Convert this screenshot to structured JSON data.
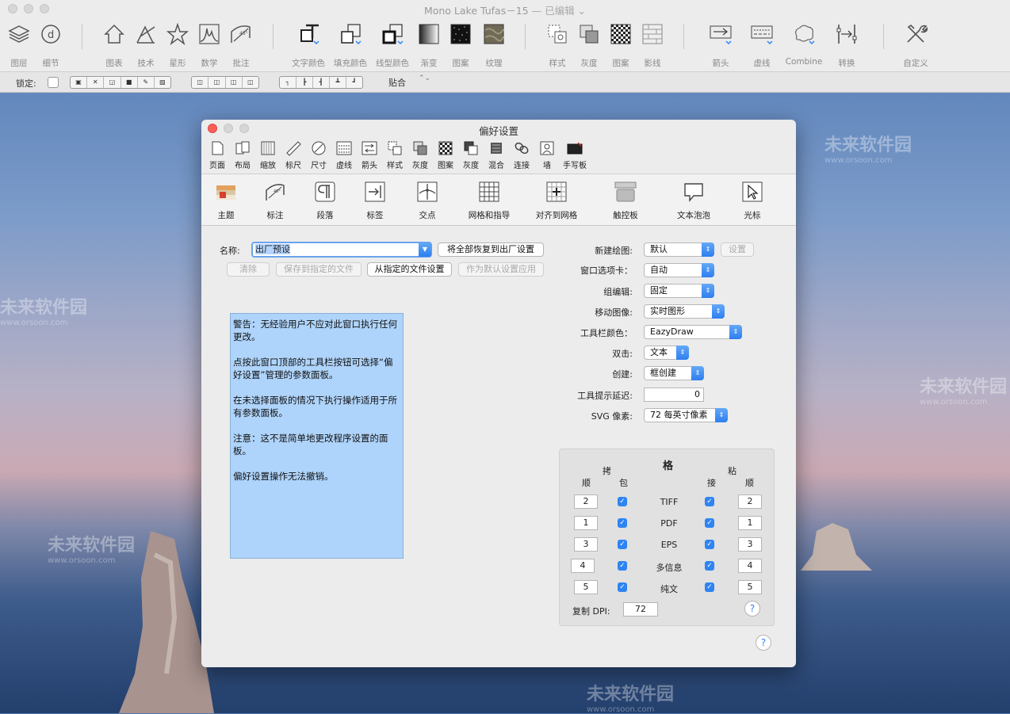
{
  "app": {
    "window_title": "Mono Lake Tufas－15",
    "window_status": " — 已编辑 ⌄"
  },
  "toolbar": {
    "items": [
      {
        "label": "图层",
        "icon": "layers-icon"
      },
      {
        "label": "细节",
        "icon": "detail-icon"
      },
      {
        "label": "图表",
        "icon": "house-shape-icon"
      },
      {
        "label": "技术",
        "icon": "technical-icon"
      },
      {
        "label": "星形",
        "icon": "star-icon"
      },
      {
        "label": "数学",
        "icon": "math-icon"
      },
      {
        "label": "批注",
        "icon": "annotation-icon"
      },
      {
        "label": "文字颜色",
        "icon": "text-color-icon"
      },
      {
        "label": "填充颜色",
        "icon": "fill-color-icon"
      },
      {
        "label": "线型颜色",
        "icon": "line-color-icon"
      },
      {
        "label": "渐变",
        "icon": "gradient-icon"
      },
      {
        "label": "图案",
        "icon": "pattern-icon"
      },
      {
        "label": "纹理",
        "icon": "texture-icon"
      },
      {
        "label": "样式",
        "icon": "style-icon"
      },
      {
        "label": "灰度",
        "icon": "gray-icon"
      },
      {
        "label": "图案",
        "icon": "checker-icon"
      },
      {
        "label": "影线",
        "icon": "hatch-icon"
      },
      {
        "label": "箭头",
        "icon": "arrow-icon"
      },
      {
        "label": "虚线",
        "icon": "dash-icon"
      },
      {
        "label": "Combine",
        "icon": "combine-icon"
      },
      {
        "label": "转换",
        "icon": "transform-icon"
      },
      {
        "label": "自定义",
        "icon": "customize-icon"
      }
    ]
  },
  "secondbar": {
    "lock_label": "锁定:",
    "snap_label": "贴合",
    "snap_arrows": "⌃⌄"
  },
  "prefs": {
    "title": "偏好设置",
    "icon_bar": [
      {
        "label": "页面",
        "icon": "page-icon"
      },
      {
        "label": "布局",
        "icon": "layout-icon"
      },
      {
        "label": "缩放",
        "icon": "zoom-icon"
      },
      {
        "label": "标尺",
        "icon": "ruler-icon"
      },
      {
        "label": "尺寸",
        "icon": "size-icon"
      },
      {
        "label": "虚线",
        "icon": "dash-line-icon"
      },
      {
        "label": "箭头",
        "icon": "arrowhead-icon"
      },
      {
        "label": "样式",
        "icon": "style-icon"
      },
      {
        "label": "灰度",
        "icon": "gray-icon"
      },
      {
        "label": "图案",
        "icon": "pattern-icon"
      },
      {
        "label": "灰度",
        "icon": "gray-scale-icon"
      },
      {
        "label": "混合",
        "icon": "blend-icon"
      },
      {
        "label": "连接",
        "icon": "link-icon"
      },
      {
        "label": "墙",
        "icon": "wall-icon"
      },
      {
        "label": "手写板",
        "icon": "tablet-icon"
      }
    ],
    "tabs": [
      {
        "label": "主题",
        "icon": "theme-icon"
      },
      {
        "label": "标注",
        "icon": "dimension-icon"
      },
      {
        "label": "段落",
        "icon": "paragraph-icon"
      },
      {
        "label": "标签",
        "icon": "tag-icon"
      },
      {
        "label": "交点",
        "icon": "intersection-icon"
      },
      {
        "label": "网格和指导",
        "icon": "grid-icon"
      },
      {
        "label": "对齐到网格",
        "icon": "snap-grid-icon"
      },
      {
        "label": "触控板",
        "icon": "trackpad-icon"
      },
      {
        "label": "文本泡泡",
        "icon": "speech-bubble-icon"
      },
      {
        "label": "光标",
        "icon": "cursor-icon"
      }
    ],
    "name_label": "名称:",
    "name_value": "出厂预设",
    "restore_button": "将全部恢复到出厂设置",
    "clear_button": "清除",
    "save_file_button": "保存到指定的文件",
    "from_file_button": "从指定的文件设置",
    "apply_default_button": "作为默认设置应用",
    "warning": {
      "p1": "警告：无经验用户不应对此窗口执行任何更改。",
      "p2": "点按此窗口顶部的工具栏按钮可选择“偏好设置”管理的参数面板。",
      "p3": "在未选择面板的情况下执行操作适用于所有参数面板。",
      "p4": " 注意：这不是简单地更改程序设置的面板。",
      "p5": "偏好设置操作无法撤销。"
    },
    "settings": {
      "new_drawing_label": "新建绘图:",
      "new_drawing_value": "默认",
      "setup_button": "设置",
      "window_tabs_label": "窗口选项卡：",
      "window_tabs_value": "自动",
      "group_edit_label": "组编辑:",
      "group_edit_value": "固定",
      "move_image_label": "移动图像:",
      "move_image_value": "实时图形",
      "toolbar_color_label": "工具栏颜色：",
      "toolbar_color_value": "EazyDraw",
      "double_click_label": "双击:",
      "double_click_value": "文本",
      "create_label": "创建:",
      "create_value": "框创建",
      "tooltip_delay_label": "工具提示延迟:",
      "tooltip_delay_value": "0",
      "svg_pixels_label": "SVG 像素:",
      "svg_pixels_value": "72 每英寸像素"
    },
    "clipboard": {
      "copy_header": "拷",
      "format_header": "格",
      "paste_header": "粘",
      "order_header": "顺",
      "include_header": "包",
      "accept_header": "接",
      "order_header_right": "顺",
      "rows": [
        {
          "copy_order": "2",
          "format": "TIFF",
          "paste_order": "2"
        },
        {
          "copy_order": "1",
          "format": "PDF",
          "paste_order": "1"
        },
        {
          "copy_order": "3",
          "format": "EPS",
          "paste_order": "3"
        },
        {
          "copy_order": "4",
          "format": "多信息",
          "paste_order": "4"
        },
        {
          "copy_order": "5",
          "format": "纯文",
          "paste_order": "5"
        }
      ],
      "dpi_label": "复制 DPI:",
      "dpi_value": "72",
      "help_text": "?"
    },
    "help_text": "?"
  },
  "watermark": {
    "text": "未来软件园",
    "url": "www.orsoon.com"
  },
  "colors": {
    "accent": "#2f84f3",
    "close": "#fc5f57"
  }
}
